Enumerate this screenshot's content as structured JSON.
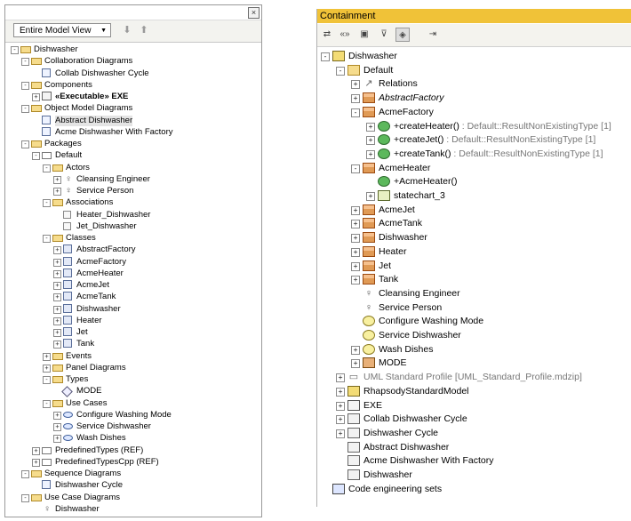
{
  "left_panel": {
    "close_glyph": "×",
    "view_select": "Entire Model View",
    "view_dropdown_glyph": "▼",
    "down_glyph": "⬇",
    "up_glyph": "⬆",
    "tree": [
      {
        "l": 0,
        "exp": "-",
        "icon": "open",
        "label": "Dishwasher"
      },
      {
        "l": 1,
        "exp": "-",
        "icon": "open",
        "label": "Collaboration Diagrams"
      },
      {
        "l": 2,
        "exp": "",
        "icon": "diag",
        "label": "Collab Dishwasher Cycle"
      },
      {
        "l": 1,
        "exp": "-",
        "icon": "open",
        "label": "Components"
      },
      {
        "l": 2,
        "exp": "+",
        "icon": "comp",
        "label": "«Executable» EXE",
        "bold": true
      },
      {
        "l": 1,
        "exp": "-",
        "icon": "open",
        "label": "Object Model Diagrams"
      },
      {
        "l": 2,
        "exp": "",
        "icon": "diag",
        "label": "Abstract Dishwasher",
        "selected": true
      },
      {
        "l": 2,
        "exp": "",
        "icon": "diag",
        "label": "Acme Dishwasher With Factory"
      },
      {
        "l": 1,
        "exp": "-",
        "icon": "open",
        "label": "Packages"
      },
      {
        "l": 2,
        "exp": "-",
        "icon": "pkg",
        "label": "Default"
      },
      {
        "l": 3,
        "exp": "-",
        "icon": "open",
        "label": "Actors"
      },
      {
        "l": 4,
        "exp": "+",
        "icon": "actor",
        "label": "Cleansing Engineer"
      },
      {
        "l": 4,
        "exp": "+",
        "icon": "actor",
        "label": "Service Person"
      },
      {
        "l": 3,
        "exp": "-",
        "icon": "open",
        "label": "Associations"
      },
      {
        "l": 4,
        "exp": "",
        "icon": "assoc",
        "label": "Heater_Dishwasher"
      },
      {
        "l": 4,
        "exp": "",
        "icon": "assoc",
        "label": "Jet_Dishwasher"
      },
      {
        "l": 3,
        "exp": "-",
        "icon": "open",
        "label": "Classes"
      },
      {
        "l": 4,
        "exp": "+",
        "icon": "cls",
        "label": "AbstractFactory"
      },
      {
        "l": 4,
        "exp": "+",
        "icon": "cls",
        "label": "AcmeFactory"
      },
      {
        "l": 4,
        "exp": "+",
        "icon": "cls",
        "label": "AcmeHeater"
      },
      {
        "l": 4,
        "exp": "+",
        "icon": "cls",
        "label": "AcmeJet"
      },
      {
        "l": 4,
        "exp": "+",
        "icon": "cls",
        "label": "AcmeTank"
      },
      {
        "l": 4,
        "exp": "+",
        "icon": "cls",
        "label": "Dishwasher"
      },
      {
        "l": 4,
        "exp": "+",
        "icon": "cls",
        "label": "Heater"
      },
      {
        "l": 4,
        "exp": "+",
        "icon": "cls",
        "label": "Jet"
      },
      {
        "l": 4,
        "exp": "+",
        "icon": "cls",
        "label": "Tank"
      },
      {
        "l": 3,
        "exp": "+",
        "icon": "open",
        "label": "Events"
      },
      {
        "l": 3,
        "exp": "+",
        "icon": "open",
        "label": "Panel Diagrams"
      },
      {
        "l": 3,
        "exp": "-",
        "icon": "open",
        "label": "Types"
      },
      {
        "l": 4,
        "exp": "",
        "icon": "diamond",
        "label": "MODE"
      },
      {
        "l": 3,
        "exp": "-",
        "icon": "open",
        "label": "Use Cases"
      },
      {
        "l": 4,
        "exp": "+",
        "icon": "uc",
        "label": "Configure Washing Mode"
      },
      {
        "l": 4,
        "exp": "+",
        "icon": "uc",
        "label": "Service Dishwasher"
      },
      {
        "l": 4,
        "exp": "+",
        "icon": "uc",
        "label": "Wash Dishes"
      },
      {
        "l": 2,
        "exp": "+",
        "icon": "pkg",
        "label": "PredefinedTypes (REF)"
      },
      {
        "l": 2,
        "exp": "+",
        "icon": "pkg",
        "label": "PredefinedTypesCpp (REF)"
      },
      {
        "l": 1,
        "exp": "-",
        "icon": "open",
        "label": "Sequence Diagrams"
      },
      {
        "l": 2,
        "exp": "",
        "icon": "diag",
        "label": "Dishwasher Cycle"
      },
      {
        "l": 1,
        "exp": "-",
        "icon": "open",
        "label": "Use Case Diagrams"
      },
      {
        "l": 2,
        "exp": "",
        "icon": "actor",
        "label": "Dishwasher"
      }
    ]
  },
  "right_panel": {
    "title": "Containment",
    "toolbar_glyphs": [
      "⇄",
      "«»",
      "▣",
      "⊽",
      "◈",
      "⇥"
    ],
    "tree": [
      {
        "l": 0,
        "exp": "-",
        "icon": "pkg",
        "label": "Dishwasher"
      },
      {
        "l": 1,
        "exp": "-",
        "icon": "folder",
        "label": "Default"
      },
      {
        "l": 2,
        "exp": "+",
        "icon": "rel",
        "label": "Relations"
      },
      {
        "l": 2,
        "exp": "+",
        "icon": "cls",
        "label": "AbstractFactory",
        "italic": true
      },
      {
        "l": 2,
        "exp": "-",
        "icon": "cls",
        "label": "AcmeFactory"
      },
      {
        "l": 3,
        "exp": "+",
        "icon": "op",
        "label": "+createHeater()",
        "gray": " : Default::ResultNonExistingType [1]"
      },
      {
        "l": 3,
        "exp": "+",
        "icon": "op",
        "label": "+createJet()",
        "gray": " : Default::ResultNonExistingType [1]"
      },
      {
        "l": 3,
        "exp": "+",
        "icon": "op",
        "label": "+createTank()",
        "gray": " : Default::ResultNonExistingType [1]"
      },
      {
        "l": 2,
        "exp": "-",
        "icon": "cls",
        "label": "AcmeHeater"
      },
      {
        "l": 3,
        "exp": "",
        "icon": "op",
        "label": "+AcmeHeater()"
      },
      {
        "l": 3,
        "exp": "+",
        "icon": "sc",
        "label": "statechart_3"
      },
      {
        "l": 2,
        "exp": "+",
        "icon": "cls",
        "label": "AcmeJet"
      },
      {
        "l": 2,
        "exp": "+",
        "icon": "cls",
        "label": "AcmeTank"
      },
      {
        "l": 2,
        "exp": "+",
        "icon": "cls",
        "label": "Dishwasher"
      },
      {
        "l": 2,
        "exp": "+",
        "icon": "cls",
        "label": "Heater"
      },
      {
        "l": 2,
        "exp": "+",
        "icon": "cls",
        "label": "Jet"
      },
      {
        "l": 2,
        "exp": "+",
        "icon": "cls",
        "label": "Tank"
      },
      {
        "l": 2,
        "exp": "",
        "icon": "actor",
        "label": "Cleansing Engineer"
      },
      {
        "l": 2,
        "exp": "",
        "icon": "actor",
        "label": "Service Person"
      },
      {
        "l": 2,
        "exp": "",
        "icon": "uc",
        "label": "Configure Washing Mode"
      },
      {
        "l": 2,
        "exp": "",
        "icon": "uc",
        "label": "Service Dishwasher"
      },
      {
        "l": 2,
        "exp": "+",
        "icon": "uc",
        "label": "Wash Dishes"
      },
      {
        "l": 2,
        "exp": "+",
        "icon": "mode",
        "label": "MODE"
      },
      {
        "l": 1,
        "exp": "+",
        "icon": "uml",
        "label": "UML Standard Profile [UML_Standard_Profile.mdzip]",
        "grayall": true
      },
      {
        "l": 1,
        "exp": "+",
        "icon": "pkg",
        "label": "RhapsodyStandardModel"
      },
      {
        "l": 1,
        "exp": "+",
        "icon": "exe",
        "label": "EXE"
      },
      {
        "l": 1,
        "exp": "+",
        "icon": "diag",
        "label": "Collab Dishwasher Cycle"
      },
      {
        "l": 1,
        "exp": "+",
        "icon": "diag",
        "label": "Dishwasher Cycle"
      },
      {
        "l": 1,
        "exp": "",
        "icon": "diag",
        "label": "Abstract Dishwasher"
      },
      {
        "l": 1,
        "exp": "",
        "icon": "diag",
        "label": "Acme Dishwasher With Factory"
      },
      {
        "l": 1,
        "exp": "",
        "icon": "diag",
        "label": "Dishwasher"
      },
      {
        "l": 0,
        "exp": "",
        "icon": "ce",
        "label": "Code engineering sets"
      }
    ]
  },
  "icon_glyphs": {
    "actor": "♀",
    "rel": "↗",
    "uml": "▭",
    "exe": "▯"
  }
}
